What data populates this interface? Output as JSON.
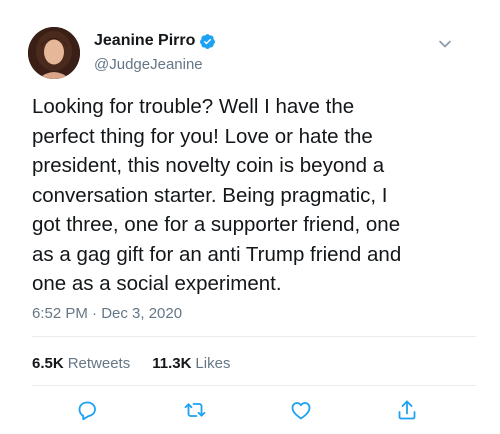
{
  "author": {
    "display_name": "Jeanine Pirro",
    "handle": "@JudgeJeanine"
  },
  "tweet": {
    "text": "Looking for trouble? Well I have the\nperfect thing for you! Love or hate the\npresident, this novelty coin is beyond a\nconversation starter. Being pragmatic, I\ngot three, one for a supporter friend, one\nas a gag gift for an anti Trump friend and\none as a social experiment.",
    "timestamp": "6:52 PM · Dec 3, 2020"
  },
  "stats": {
    "retweets_count": "6.5K",
    "retweets_label": "Retweets",
    "likes_count": "11.3K",
    "likes_label": "Likes"
  },
  "icons": {
    "verified": "verified-badge-icon",
    "caret": "chevron-down-icon",
    "reply": "reply-icon",
    "retweet": "retweet-icon",
    "like": "heart-icon",
    "share": "share-icon"
  },
  "colors": {
    "verified_blue": "#1da1f2",
    "secondary_text": "#657786",
    "primary_text": "#14171a",
    "action_icon": "#1da1f2",
    "divider": "#e6ecf0"
  }
}
